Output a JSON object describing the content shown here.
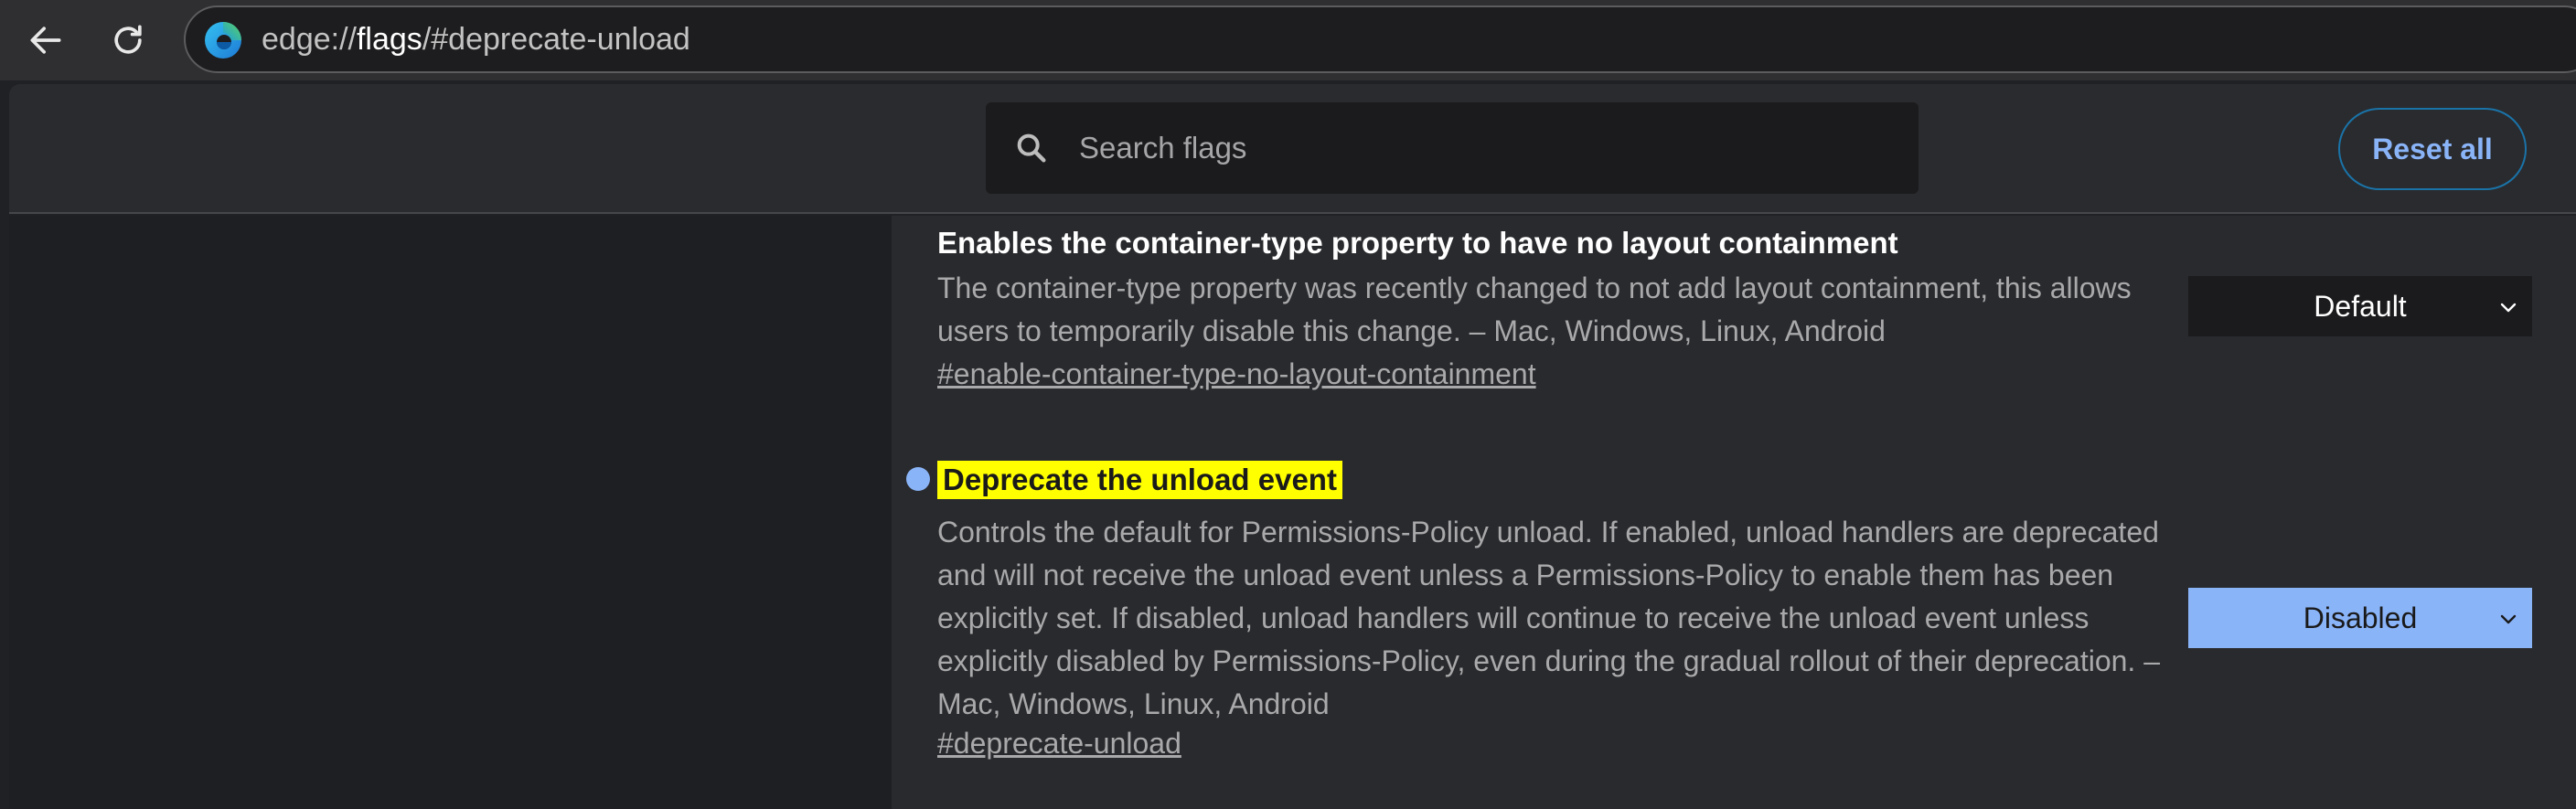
{
  "browser": {
    "url_scheme": "edge://",
    "url_host": "flags",
    "url_path": "/#deprecate-unload",
    "icons": {
      "back": "back-arrow-icon",
      "reload": "reload-icon",
      "site": "edge-logo-icon"
    }
  },
  "header": {
    "search_placeholder": "Search flags",
    "reset_label": "Reset all"
  },
  "flags": [
    {
      "title": "Enables the container-type property to have no layout containment",
      "description": "The container-type property was recently changed to not add layout containment, this allows users to temporarily disable this change. – Mac, Windows, Linux, Android",
      "link": "#enable-container-type-no-layout-containment",
      "value": "Default",
      "modified": false
    },
    {
      "title": "Deprecate the unload event",
      "description": "Controls the default for Permissions-Policy unload. If enabled, unload handlers are deprecated and will not receive the unload event unless a Permissions-Policy to enable them has been explicitly set. If disabled, unload handlers will continue to receive the unload event unless explicitly disabled by Permissions-Policy, even during the gradual rollout of their deprecation. – Mac, Windows, Linux, Android",
      "link": "#deprecate-unload",
      "value": "Disabled",
      "modified": true,
      "highlighted": true
    }
  ],
  "colors": {
    "accent": "#8ab4f8",
    "highlight": "#ffff00",
    "background": "#202124"
  }
}
